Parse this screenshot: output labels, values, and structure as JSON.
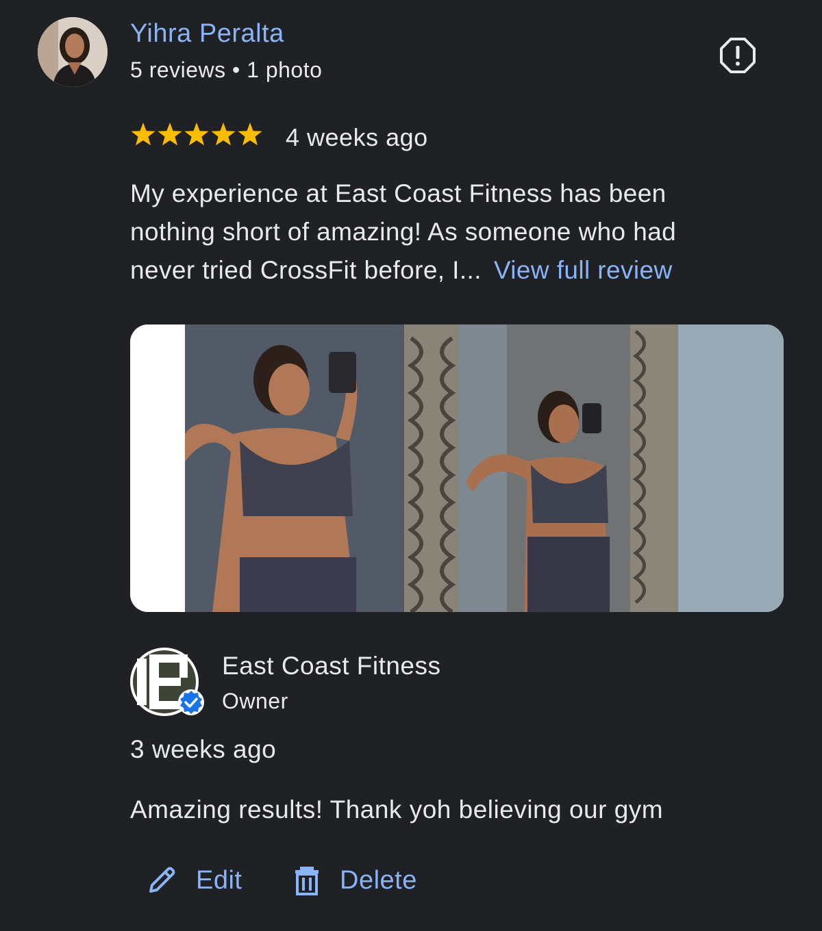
{
  "reviewer": {
    "name": "Yihra Peralta",
    "meta": "5 reviews • 1 photo",
    "avatar_icon": "profile-photo"
  },
  "report_icon": "report-icon",
  "review": {
    "rating": 5,
    "max_rating": 5,
    "time": "4 weeks ago",
    "text": "My experience at East Coast Fitness has been nothing short of amazing! As someone who had never tried CrossFit before, I...",
    "more_label": "View full review"
  },
  "owner_response": {
    "name": "East Coast Fitness",
    "role": "Owner",
    "time": "3 weeks ago",
    "text": "Amazing results! Thank yoh believing our gym",
    "logo_icon": "business-logo",
    "verified_icon": "verified-badge-icon"
  },
  "actions": {
    "edit_label": "Edit",
    "edit_icon": "pencil-icon",
    "delete_label": "Delete",
    "delete_icon": "trash-icon"
  },
  "colors": {
    "background": "#202124",
    "link": "#8ab4f8",
    "text": "#e8eaed",
    "star": "#fbbc04",
    "verified": "#1a73e8"
  }
}
